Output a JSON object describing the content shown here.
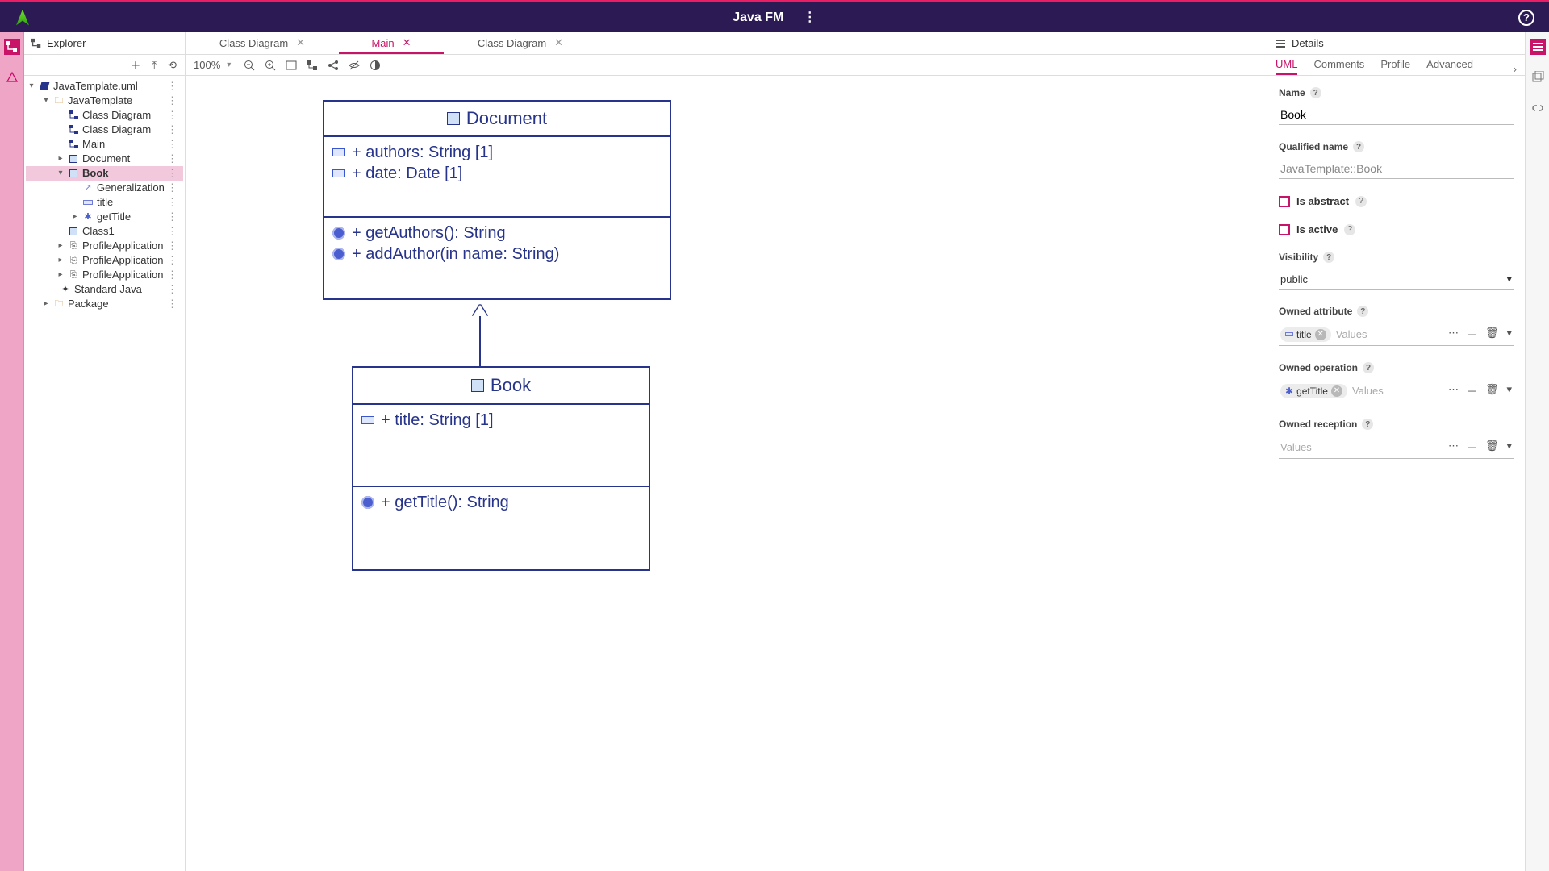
{
  "titlebar": {
    "title": "Java FM"
  },
  "explorer": {
    "title": "Explorer",
    "tree": {
      "root": {
        "label": "JavaTemplate.uml"
      },
      "pkg": {
        "label": "JavaTemplate"
      },
      "diagram1": {
        "label": "Class Diagram"
      },
      "diagram2": {
        "label": "Class Diagram"
      },
      "diagram3": {
        "label": "Main"
      },
      "documentClass": {
        "label": "Document"
      },
      "bookClass": {
        "label": "Book"
      },
      "generalization": {
        "label": "Generalization"
      },
      "titleAttr": {
        "label": "title"
      },
      "getTitleOp": {
        "label": "getTitle"
      },
      "class1": {
        "label": "Class1"
      },
      "profApp1": {
        "label": "ProfileApplication"
      },
      "profApp2": {
        "label": "ProfileApplication"
      },
      "profApp3": {
        "label": "ProfileApplication"
      },
      "stdJava": {
        "label": "Standard Java"
      },
      "packageNode": {
        "label": "Package"
      }
    }
  },
  "editor": {
    "tabs": [
      {
        "label": "Class Diagram",
        "active": false
      },
      {
        "label": "Main",
        "active": true
      },
      {
        "label": "Class Diagram",
        "active": false
      }
    ],
    "zoom": "100%"
  },
  "diagram": {
    "document": {
      "name": "Document",
      "attrs": [
        "+ authors: String [1]",
        "+ date: Date [1]"
      ],
      "ops": [
        "+ getAuthors(): String",
        "+ addAuthor(in name: String)"
      ]
    },
    "book": {
      "name": "Book",
      "attrs": [
        "+ title: String [1]"
      ],
      "ops": [
        "+ getTitle(): String"
      ]
    }
  },
  "details": {
    "title": "Details",
    "tabs": {
      "t0": "UML",
      "t1": "Comments",
      "t2": "Profile",
      "t3": "Advanced"
    },
    "fields": {
      "nameLabel": "Name",
      "nameValue": "Book",
      "qualLabel": "Qualified name",
      "qualValue": "JavaTemplate::Book",
      "isAbstractLabel": "Is abstract",
      "isActiveLabel": "Is active",
      "visibilityLabel": "Visibility",
      "visibilityValue": "public",
      "ownedAttrLabel": "Owned attribute",
      "ownedAttrChip": "title",
      "ownedOpLabel": "Owned operation",
      "ownedOpChip": "getTitle",
      "ownedRecLabel": "Owned reception",
      "valuesPlaceholder": "Values"
    }
  }
}
